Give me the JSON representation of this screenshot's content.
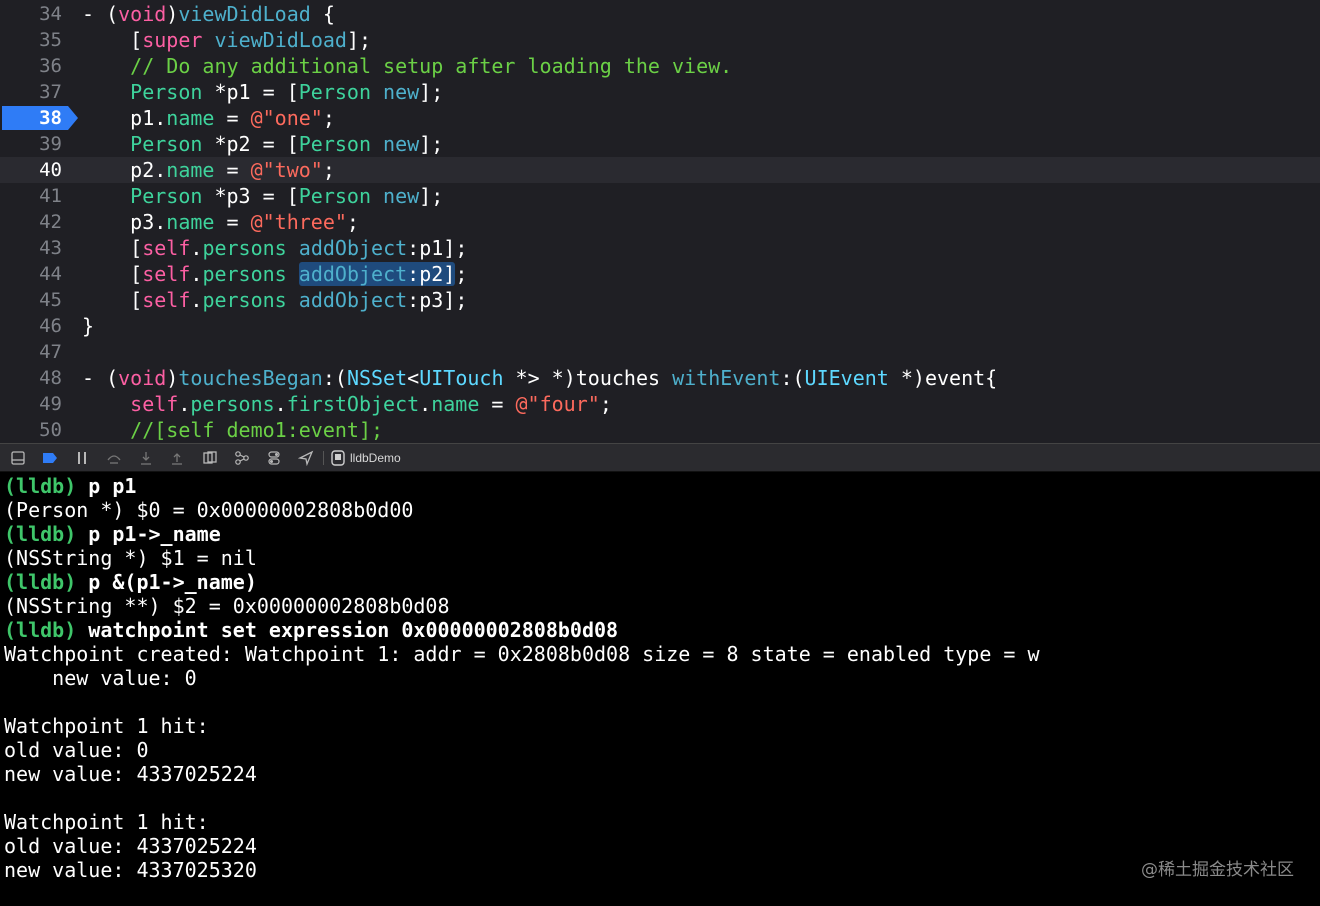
{
  "editor": {
    "current_line": "40",
    "breakpoint_line": "38",
    "lines": [
      {
        "num": "34",
        "tokens": [
          {
            "t": "tx",
            "v": "- ("
          },
          {
            "t": "kw",
            "v": "void"
          },
          {
            "t": "tx",
            "v": ")"
          },
          {
            "t": "fn",
            "v": "viewDidLoad"
          },
          {
            "t": "tx",
            "v": " {"
          }
        ]
      },
      {
        "num": "35",
        "tokens": [
          {
            "t": "tx",
            "v": "    ["
          },
          {
            "t": "kw",
            "v": "super"
          },
          {
            "t": "tx",
            "v": " "
          },
          {
            "t": "fn",
            "v": "viewDidLoad"
          },
          {
            "t": "tx",
            "v": "];"
          }
        ]
      },
      {
        "num": "36",
        "tokens": [
          {
            "t": "cm",
            "v": "    // Do any additional setup after loading the view."
          }
        ]
      },
      {
        "num": "37",
        "tokens": [
          {
            "t": "tx",
            "v": "    "
          },
          {
            "t": "cl",
            "v": "Person"
          },
          {
            "t": "tx",
            "v": " *p1 = ["
          },
          {
            "t": "cl",
            "v": "Person"
          },
          {
            "t": "tx",
            "v": " "
          },
          {
            "t": "fn",
            "v": "new"
          },
          {
            "t": "tx",
            "v": "];"
          }
        ]
      },
      {
        "num": "38",
        "tokens": [
          {
            "t": "tx",
            "v": "    p1."
          },
          {
            "t": "cl",
            "v": "name"
          },
          {
            "t": "tx",
            "v": " = "
          },
          {
            "t": "st",
            "v": "@\"one\""
          },
          {
            "t": "tx",
            "v": ";"
          }
        ]
      },
      {
        "num": "39",
        "tokens": [
          {
            "t": "tx",
            "v": "    "
          },
          {
            "t": "cl",
            "v": "Person"
          },
          {
            "t": "tx",
            "v": " *p2 = ["
          },
          {
            "t": "cl",
            "v": "Person"
          },
          {
            "t": "tx",
            "v": " "
          },
          {
            "t": "fn",
            "v": "new"
          },
          {
            "t": "tx",
            "v": "];"
          }
        ]
      },
      {
        "num": "40",
        "tokens": [
          {
            "t": "tx",
            "v": "    p2."
          },
          {
            "t": "cl",
            "v": "name"
          },
          {
            "t": "tx",
            "v": " = "
          },
          {
            "t": "st",
            "v": "@\"two\""
          },
          {
            "t": "tx",
            "v": ";"
          }
        ]
      },
      {
        "num": "41",
        "tokens": [
          {
            "t": "tx",
            "v": "    "
          },
          {
            "t": "cl",
            "v": "Person"
          },
          {
            "t": "tx",
            "v": " *p3 = ["
          },
          {
            "t": "cl",
            "v": "Person"
          },
          {
            "t": "tx",
            "v": " "
          },
          {
            "t": "fn",
            "v": "new"
          },
          {
            "t": "tx",
            "v": "];"
          }
        ]
      },
      {
        "num": "42",
        "tokens": [
          {
            "t": "tx",
            "v": "    p3."
          },
          {
            "t": "cl",
            "v": "name"
          },
          {
            "t": "tx",
            "v": " = "
          },
          {
            "t": "st",
            "v": "@\"three\""
          },
          {
            "t": "tx",
            "v": ";"
          }
        ]
      },
      {
        "num": "43",
        "tokens": [
          {
            "t": "tx",
            "v": "    ["
          },
          {
            "t": "kw",
            "v": "self"
          },
          {
            "t": "tx",
            "v": "."
          },
          {
            "t": "cl",
            "v": "persons"
          },
          {
            "t": "tx",
            "v": " "
          },
          {
            "t": "fn",
            "v": "addObject"
          },
          {
            "t": "tx",
            "v": ":p1];"
          }
        ]
      },
      {
        "num": "44",
        "tokens": [
          {
            "t": "tx",
            "v": "    ["
          },
          {
            "t": "kw",
            "v": "self"
          },
          {
            "t": "tx",
            "v": "."
          },
          {
            "t": "cl",
            "v": "persons"
          },
          {
            "t": "tx",
            "v": " "
          },
          {
            "t": "fn",
            "v": "addObject",
            "sel": true
          },
          {
            "t": "tx",
            "v": ":p2]",
            "sel": true
          },
          {
            "t": "tx",
            "v": ";"
          }
        ]
      },
      {
        "num": "45",
        "tokens": [
          {
            "t": "tx",
            "v": "    ["
          },
          {
            "t": "kw",
            "v": "self"
          },
          {
            "t": "tx",
            "v": "."
          },
          {
            "t": "cl",
            "v": "persons"
          },
          {
            "t": "tx",
            "v": " "
          },
          {
            "t": "fn",
            "v": "addObject"
          },
          {
            "t": "tx",
            "v": ":p3];"
          }
        ]
      },
      {
        "num": "46",
        "tokens": [
          {
            "t": "tx",
            "v": "}"
          }
        ]
      },
      {
        "num": "47",
        "tokens": []
      },
      {
        "num": "48",
        "tokens": [
          {
            "t": "tx",
            "v": "- ("
          },
          {
            "t": "kw",
            "v": "void"
          },
          {
            "t": "tx",
            "v": ")"
          },
          {
            "t": "fn",
            "v": "touchesBegan"
          },
          {
            "t": "tx",
            "v": ":("
          },
          {
            "t": "ty",
            "v": "NSSet"
          },
          {
            "t": "tx",
            "v": "<"
          },
          {
            "t": "ty",
            "v": "UITouch"
          },
          {
            "t": "tx",
            "v": " *> *)touches "
          },
          {
            "t": "fn",
            "v": "withEvent"
          },
          {
            "t": "tx",
            "v": ":("
          },
          {
            "t": "ty",
            "v": "UIEvent"
          },
          {
            "t": "tx",
            "v": " *)event{"
          }
        ]
      },
      {
        "num": "49",
        "tokens": [
          {
            "t": "kw",
            "v": "    self"
          },
          {
            "t": "tx",
            "v": "."
          },
          {
            "t": "cl",
            "v": "persons"
          },
          {
            "t": "tx",
            "v": "."
          },
          {
            "t": "cl",
            "v": "firstObject"
          },
          {
            "t": "tx",
            "v": "."
          },
          {
            "t": "cl",
            "v": "name"
          },
          {
            "t": "tx",
            "v": " = "
          },
          {
            "t": "st",
            "v": "@\"four\""
          },
          {
            "t": "tx",
            "v": ";"
          }
        ]
      },
      {
        "num": "50",
        "tokens": [
          {
            "t": "cm",
            "v": "    //[self demo1:event];"
          }
        ]
      }
    ]
  },
  "debug_bar": {
    "icons": [
      "hide-console-icon",
      "breakpoints-toggle-icon",
      "pause-icon",
      "step-over-icon",
      "step-into-icon",
      "step-out-icon",
      "view-hierarchy-icon",
      "memory-graph-icon",
      "environment-overrides-icon",
      "simulate-location-icon"
    ],
    "process_label": "lldbDemo"
  },
  "console": {
    "lines": [
      {
        "prompt": "(lldb)",
        "text": " p p1"
      },
      {
        "text": "(Person *) $0 = 0x00000002808b0d00"
      },
      {
        "prompt": "(lldb)",
        "text": " p p1->_name"
      },
      {
        "text": "(NSString *) $1 = nil"
      },
      {
        "prompt": "(lldb)",
        "text": " p &(p1->_name)"
      },
      {
        "text": "(NSString **) $2 = 0x00000002808b0d08"
      },
      {
        "prompt": "(lldb)",
        "text": " watchpoint set expression 0x00000002808b0d08"
      },
      {
        "text": "Watchpoint created: Watchpoint 1: addr = 0x2808b0d08 size = 8 state = enabled type = w"
      },
      {
        "text": "    new value: 0"
      },
      {
        "text": ""
      },
      {
        "text": "Watchpoint 1 hit:"
      },
      {
        "text": "old value: 0"
      },
      {
        "text": "new value: 4337025224"
      },
      {
        "text": ""
      },
      {
        "text": "Watchpoint 1 hit:"
      },
      {
        "text": "old value: 4337025224"
      },
      {
        "text": "new value: 4337025320"
      }
    ]
  },
  "watermark": "@稀土掘金技术社区",
  "colors": {
    "editor_bg": "#1f1f24",
    "breakpoint": "#2f7cf6",
    "keyword": "#fc5fa3",
    "function": "#4eb0cc",
    "class": "#3ed39c",
    "string": "#fc6a5d",
    "comment": "#6bd046",
    "lldb_prompt": "#3fc66a"
  }
}
